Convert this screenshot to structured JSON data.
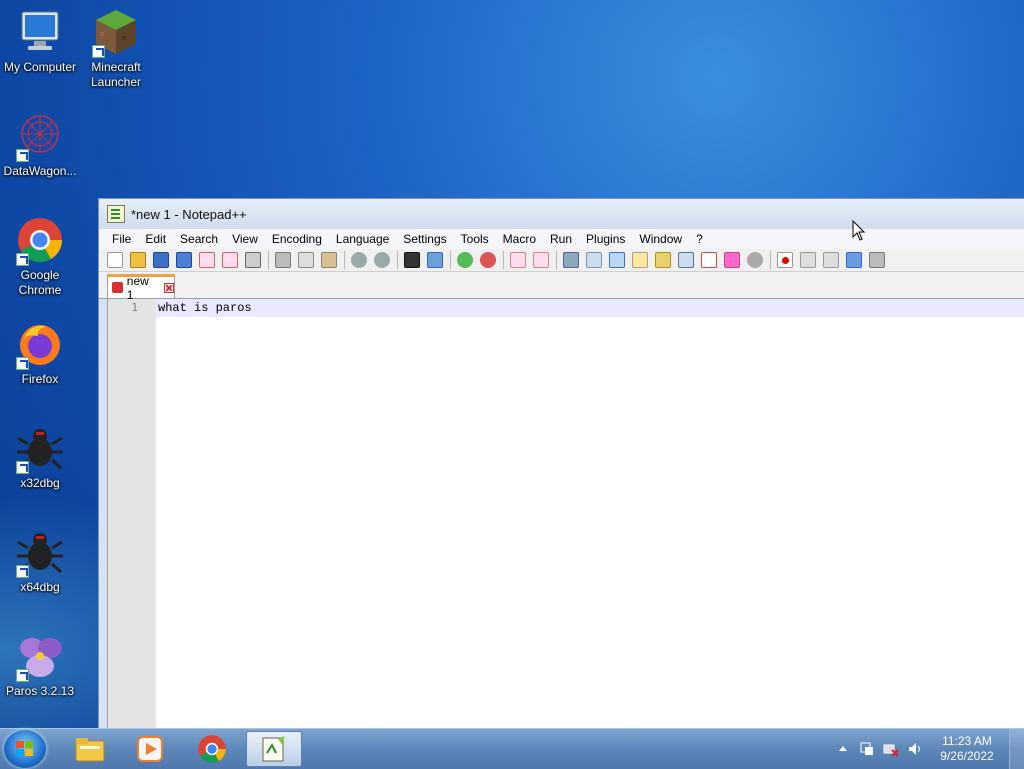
{
  "desktop": {
    "icons": [
      {
        "label": "My Computer"
      },
      {
        "label": "Minecraft Launcher"
      },
      {
        "label": "DataWagon..."
      },
      {
        "label": "Google Chrome"
      },
      {
        "label": "Firefox"
      },
      {
        "label": "x32dbg"
      },
      {
        "label": "x64dbg"
      },
      {
        "label": "Paros 3.2.13"
      }
    ]
  },
  "window": {
    "title": "*new 1 - Notepad++",
    "menu": [
      "File",
      "Edit",
      "Search",
      "View",
      "Encoding",
      "Language",
      "Settings",
      "Tools",
      "Macro",
      "Run",
      "Plugins",
      "Window",
      "?"
    ],
    "tab_label": "new 1",
    "line_number": "1",
    "line_text": "what is paros"
  },
  "taskbar": {
    "pinned": [
      "explorer-icon",
      "media-player-icon",
      "chrome-icon",
      "notepad-plus-plus-icon"
    ],
    "time": "11:23 AM",
    "date": "9/26/2022"
  }
}
